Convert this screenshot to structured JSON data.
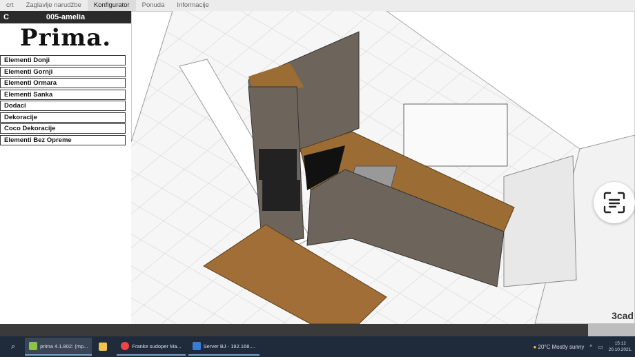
{
  "menubar": {
    "tabs": [
      "crt",
      "Zaglavlje narudžbe",
      "Konfigurator",
      "Ponuda",
      "Informacije"
    ],
    "active": 2
  },
  "sidebar": {
    "code": "C",
    "project": "005-amelia",
    "logo": "Prima.",
    "items": [
      "Elementi Donji",
      "Elementi Gornji",
      "Elementi Ormara",
      "Elementi Sanka",
      "Dodaci",
      "Dekoracije",
      "Coco Dekoracije",
      "Elementi Bez Opreme"
    ]
  },
  "view": {
    "brand": "3cad",
    "scan_icon": "scan-text-icon"
  },
  "taskbar": {
    "apps": [
      {
        "label": "prima 4.1.802: (mp...",
        "color": "#8bc34a"
      },
      {
        "label": "",
        "color": "#f2c14e"
      },
      {
        "label": "Franke sudoper Ma...",
        "color": "#e44"
      },
      {
        "label": "Server BJ - 192.168....",
        "color": "#3a7bd5"
      }
    ],
    "weather": "20°C  Mostly sunny",
    "time": "15:12",
    "date": "20.10.2021."
  }
}
